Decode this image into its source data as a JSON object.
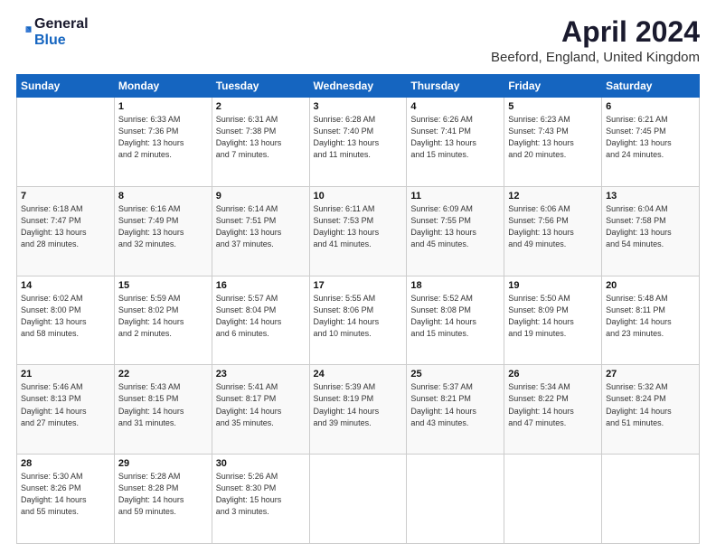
{
  "logo": {
    "general": "General",
    "blue": "Blue"
  },
  "title": "April 2024",
  "subtitle": "Beeford, England, United Kingdom",
  "days_header": [
    "Sunday",
    "Monday",
    "Tuesday",
    "Wednesday",
    "Thursday",
    "Friday",
    "Saturday"
  ],
  "weeks": [
    [
      {
        "num": "",
        "info": ""
      },
      {
        "num": "1",
        "info": "Sunrise: 6:33 AM\nSunset: 7:36 PM\nDaylight: 13 hours\nand 2 minutes."
      },
      {
        "num": "2",
        "info": "Sunrise: 6:31 AM\nSunset: 7:38 PM\nDaylight: 13 hours\nand 7 minutes."
      },
      {
        "num": "3",
        "info": "Sunrise: 6:28 AM\nSunset: 7:40 PM\nDaylight: 13 hours\nand 11 minutes."
      },
      {
        "num": "4",
        "info": "Sunrise: 6:26 AM\nSunset: 7:41 PM\nDaylight: 13 hours\nand 15 minutes."
      },
      {
        "num": "5",
        "info": "Sunrise: 6:23 AM\nSunset: 7:43 PM\nDaylight: 13 hours\nand 20 minutes."
      },
      {
        "num": "6",
        "info": "Sunrise: 6:21 AM\nSunset: 7:45 PM\nDaylight: 13 hours\nand 24 minutes."
      }
    ],
    [
      {
        "num": "7",
        "info": "Sunrise: 6:18 AM\nSunset: 7:47 PM\nDaylight: 13 hours\nand 28 minutes."
      },
      {
        "num": "8",
        "info": "Sunrise: 6:16 AM\nSunset: 7:49 PM\nDaylight: 13 hours\nand 32 minutes."
      },
      {
        "num": "9",
        "info": "Sunrise: 6:14 AM\nSunset: 7:51 PM\nDaylight: 13 hours\nand 37 minutes."
      },
      {
        "num": "10",
        "info": "Sunrise: 6:11 AM\nSunset: 7:53 PM\nDaylight: 13 hours\nand 41 minutes."
      },
      {
        "num": "11",
        "info": "Sunrise: 6:09 AM\nSunset: 7:55 PM\nDaylight: 13 hours\nand 45 minutes."
      },
      {
        "num": "12",
        "info": "Sunrise: 6:06 AM\nSunset: 7:56 PM\nDaylight: 13 hours\nand 49 minutes."
      },
      {
        "num": "13",
        "info": "Sunrise: 6:04 AM\nSunset: 7:58 PM\nDaylight: 13 hours\nand 54 minutes."
      }
    ],
    [
      {
        "num": "14",
        "info": "Sunrise: 6:02 AM\nSunset: 8:00 PM\nDaylight: 13 hours\nand 58 minutes."
      },
      {
        "num": "15",
        "info": "Sunrise: 5:59 AM\nSunset: 8:02 PM\nDaylight: 14 hours\nand 2 minutes."
      },
      {
        "num": "16",
        "info": "Sunrise: 5:57 AM\nSunset: 8:04 PM\nDaylight: 14 hours\nand 6 minutes."
      },
      {
        "num": "17",
        "info": "Sunrise: 5:55 AM\nSunset: 8:06 PM\nDaylight: 14 hours\nand 10 minutes."
      },
      {
        "num": "18",
        "info": "Sunrise: 5:52 AM\nSunset: 8:08 PM\nDaylight: 14 hours\nand 15 minutes."
      },
      {
        "num": "19",
        "info": "Sunrise: 5:50 AM\nSunset: 8:09 PM\nDaylight: 14 hours\nand 19 minutes."
      },
      {
        "num": "20",
        "info": "Sunrise: 5:48 AM\nSunset: 8:11 PM\nDaylight: 14 hours\nand 23 minutes."
      }
    ],
    [
      {
        "num": "21",
        "info": "Sunrise: 5:46 AM\nSunset: 8:13 PM\nDaylight: 14 hours\nand 27 minutes."
      },
      {
        "num": "22",
        "info": "Sunrise: 5:43 AM\nSunset: 8:15 PM\nDaylight: 14 hours\nand 31 minutes."
      },
      {
        "num": "23",
        "info": "Sunrise: 5:41 AM\nSunset: 8:17 PM\nDaylight: 14 hours\nand 35 minutes."
      },
      {
        "num": "24",
        "info": "Sunrise: 5:39 AM\nSunset: 8:19 PM\nDaylight: 14 hours\nand 39 minutes."
      },
      {
        "num": "25",
        "info": "Sunrise: 5:37 AM\nSunset: 8:21 PM\nDaylight: 14 hours\nand 43 minutes."
      },
      {
        "num": "26",
        "info": "Sunrise: 5:34 AM\nSunset: 8:22 PM\nDaylight: 14 hours\nand 47 minutes."
      },
      {
        "num": "27",
        "info": "Sunrise: 5:32 AM\nSunset: 8:24 PM\nDaylight: 14 hours\nand 51 minutes."
      }
    ],
    [
      {
        "num": "28",
        "info": "Sunrise: 5:30 AM\nSunset: 8:26 PM\nDaylight: 14 hours\nand 55 minutes."
      },
      {
        "num": "29",
        "info": "Sunrise: 5:28 AM\nSunset: 8:28 PM\nDaylight: 14 hours\nand 59 minutes."
      },
      {
        "num": "30",
        "info": "Sunrise: 5:26 AM\nSunset: 8:30 PM\nDaylight: 15 hours\nand 3 minutes."
      },
      {
        "num": "",
        "info": ""
      },
      {
        "num": "",
        "info": ""
      },
      {
        "num": "",
        "info": ""
      },
      {
        "num": "",
        "info": ""
      }
    ]
  ]
}
